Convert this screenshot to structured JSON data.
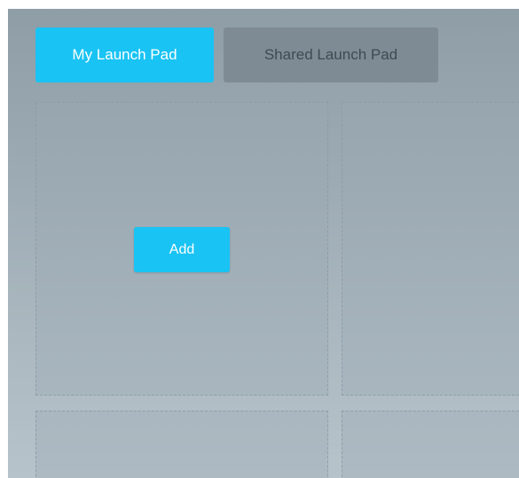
{
  "tabs": {
    "my_launch_pad": "My Launch Pad",
    "shared_launch_pad": "Shared Launch Pad",
    "active": "my_launch_pad"
  },
  "grid": {
    "add_label": "Add"
  },
  "colors": {
    "accent": "#19c3f3",
    "inactive_tab": "#7e8b94",
    "inactive_tab_text": "#3f4a51",
    "background_top": "#8f9da6",
    "background_bottom": "#b7c3ca"
  }
}
